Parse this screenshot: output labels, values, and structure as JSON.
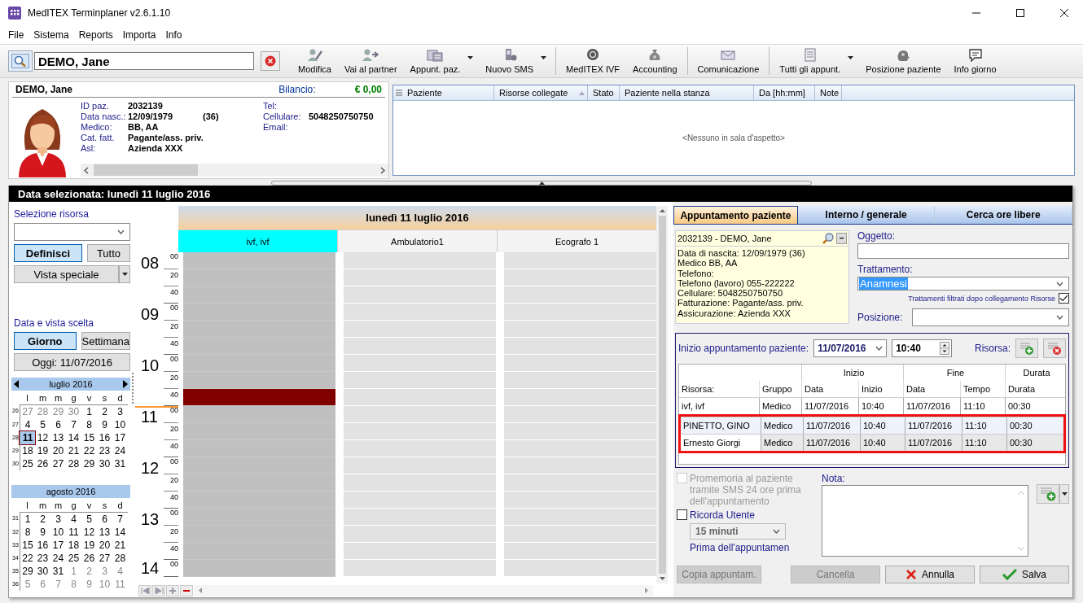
{
  "window": {
    "title": "MedITEX Terminplaner  v2.6.1.10"
  },
  "menu": [
    "File",
    "Sistema",
    "Reports",
    "Importa",
    "Info"
  ],
  "search": {
    "value": "DEMO, Jane"
  },
  "toolbar": [
    {
      "label": "Modifica",
      "dropdown": false,
      "separator_before": false
    },
    {
      "label": "Vai al partner",
      "dropdown": false,
      "separator_before": false
    },
    {
      "label": "Appunt. paz.",
      "dropdown": true,
      "separator_before": false
    },
    {
      "label": "Nuovo SMS",
      "dropdown": true,
      "separator_before": false
    },
    {
      "label": "MedITEX IVF",
      "dropdown": false,
      "separator_before": true
    },
    {
      "label": "Accounting",
      "dropdown": false,
      "separator_before": false
    },
    {
      "label": "Comunicazione",
      "dropdown": false,
      "separator_before": true
    },
    {
      "label": "Tutti gli appunt.",
      "dropdown": true,
      "separator_before": true
    },
    {
      "label": "Posizione paziente",
      "dropdown": false,
      "separator_before": false
    },
    {
      "label": "Info giorno",
      "dropdown": false,
      "separator_before": false
    }
  ],
  "patient": {
    "name": "DEMO, Jane",
    "balance_label": "Bilancio:",
    "balance": "€ 0,00",
    "fields_left": [
      {
        "label": "ID paz.",
        "value": "2032139"
      },
      {
        "label": "Data nasc.:",
        "value": "12/09/1979",
        "extra": "(36)"
      },
      {
        "label": "Medico:",
        "value": "BB, AA"
      },
      {
        "label": "Cat. fatt.",
        "value": "Pagante/ass. priv."
      },
      {
        "label": "Asl:",
        "value": "Azienda XXX"
      }
    ],
    "fields_right": [
      {
        "label": "Tel:"
      },
      {
        "label": "Cellulare:",
        "value": "5048250750750"
      },
      {
        "label": "Email:"
      }
    ]
  },
  "waiting_room": {
    "columns": [
      {
        "label": "Paziente",
        "sorted": false
      },
      {
        "label": "Risorse collegate",
        "sorted": true
      },
      {
        "label": "Stato",
        "sorted": false
      },
      {
        "label": "Paziente nella stanza",
        "sorted": false
      },
      {
        "label": "Da [hh:mm]",
        "sorted": false
      },
      {
        "label": "Note",
        "sorted": false
      }
    ],
    "empty_message": "<Nessuno in sala d'aspetto>"
  },
  "selected_date": "Data selezionata:  lunedì 11 luglio 2016",
  "sidebar": {
    "resource_label": "Selezione risorsa",
    "resource_buttons": [
      {
        "label": "Definisci",
        "selected": true
      },
      {
        "label": "Tutto",
        "selected": false
      }
    ],
    "special_view": "Vista speciale",
    "view_label": "Data e vista scelta",
    "view_buttons": [
      {
        "label": "Giorno",
        "selected": true
      },
      {
        "label": "Settimana",
        "selected": false
      }
    ],
    "today": "Oggi: 11/07/2016",
    "calendars": [
      {
        "title": "luglio 2016",
        "arrows": true,
        "weekdays": [
          "l",
          "m",
          "m",
          "g",
          "v",
          "s",
          "d"
        ],
        "weeks": [
          {
            "week": "26",
            "days": [
              {
                "t": "27",
                "muted": true,
                "selected": false
              },
              {
                "t": "28",
                "muted": true,
                "selected": false
              },
              {
                "t": "29",
                "muted": true,
                "selected": false
              },
              {
                "t": "30",
                "muted": true,
                "selected": false
              },
              {
                "t": "1",
                "muted": false,
                "selected": false
              },
              {
                "t": "2",
                "muted": false,
                "selected": false
              },
              {
                "t": "3",
                "muted": false,
                "selected": false
              }
            ]
          },
          {
            "week": "27",
            "days": [
              {
                "t": "4",
                "muted": false,
                "selected": false
              },
              {
                "t": "5",
                "muted": false,
                "selected": false
              },
              {
                "t": "6",
                "muted": false,
                "selected": false
              },
              {
                "t": "7",
                "muted": false,
                "selected": false
              },
              {
                "t": "8",
                "muted": false,
                "selected": false
              },
              {
                "t": "9",
                "muted": false,
                "selected": false
              },
              {
                "t": "10",
                "muted": false,
                "selected": false
              }
            ]
          },
          {
            "week": "28",
            "days": [
              {
                "t": "11",
                "muted": false,
                "selected": true
              },
              {
                "t": "12",
                "muted": false,
                "selected": false
              },
              {
                "t": "13",
                "muted": false,
                "selected": false
              },
              {
                "t": "14",
                "muted": false,
                "selected": false
              },
              {
                "t": "15",
                "muted": false,
                "selected": false
              },
              {
                "t": "16",
                "muted": false,
                "selected": false
              },
              {
                "t": "17",
                "muted": false,
                "selected": false
              }
            ]
          },
          {
            "week": "29",
            "days": [
              {
                "t": "18",
                "muted": false,
                "selected": false
              },
              {
                "t": "19",
                "muted": false,
                "selected": false
              },
              {
                "t": "20",
                "muted": false,
                "selected": false
              },
              {
                "t": "21",
                "muted": false,
                "selected": false
              },
              {
                "t": "22",
                "muted": false,
                "selected": false
              },
              {
                "t": "23",
                "muted": false,
                "selected": false
              },
              {
                "t": "24",
                "muted": false,
                "selected": false
              }
            ]
          },
          {
            "week": "30",
            "days": [
              {
                "t": "25",
                "muted": false,
                "selected": false
              },
              {
                "t": "26",
                "muted": false,
                "selected": false
              },
              {
                "t": "27",
                "muted": false,
                "selected": false
              },
              {
                "t": "28",
                "muted": false,
                "selected": false
              },
              {
                "t": "29",
                "muted": false,
                "selected": false
              },
              {
                "t": "30",
                "muted": false,
                "selected": false
              },
              {
                "t": "31",
                "muted": false,
                "selected": false
              }
            ]
          }
        ]
      },
      {
        "title": "agosto 2016",
        "arrows": false,
        "weekdays": [
          "l",
          "m",
          "m",
          "g",
          "v",
          "s",
          "d"
        ],
        "weeks": [
          {
            "week": "31",
            "days": [
              {
                "t": "1",
                "muted": false,
                "selected": false
              },
              {
                "t": "2",
                "muted": false,
                "selected": false
              },
              {
                "t": "3",
                "muted": false,
                "selected": false
              },
              {
                "t": "4",
                "muted": false,
                "selected": false
              },
              {
                "t": "5",
                "muted": false,
                "selected": false
              },
              {
                "t": "6",
                "muted": false,
                "selected": false
              },
              {
                "t": "7",
                "muted": false,
                "selected": false
              }
            ]
          },
          {
            "week": "32",
            "days": [
              {
                "t": "8",
                "muted": false,
                "selected": false
              },
              {
                "t": "9",
                "muted": false,
                "selected": false
              },
              {
                "t": "10",
                "muted": false,
                "selected": false
              },
              {
                "t": "11",
                "muted": false,
                "selected": false
              },
              {
                "t": "12",
                "muted": false,
                "selected": false
              },
              {
                "t": "13",
                "muted": false,
                "selected": false
              },
              {
                "t": "14",
                "muted": false,
                "selected": false
              }
            ]
          },
          {
            "week": "33",
            "days": [
              {
                "t": "15",
                "muted": false,
                "selected": false
              },
              {
                "t": "16",
                "muted": false,
                "selected": false
              },
              {
                "t": "17",
                "muted": false,
                "selected": false
              },
              {
                "t": "18",
                "muted": false,
                "selected": false
              },
              {
                "t": "19",
                "muted": false,
                "selected": false
              },
              {
                "t": "20",
                "muted": false,
                "selected": false
              },
              {
                "t": "21",
                "muted": false,
                "selected": false
              }
            ]
          },
          {
            "week": "34",
            "days": [
              {
                "t": "22",
                "muted": false,
                "selected": false
              },
              {
                "t": "23",
                "muted": false,
                "selected": false
              },
              {
                "t": "24",
                "muted": false,
                "selected": false
              },
              {
                "t": "25",
                "muted": false,
                "selected": false
              },
              {
                "t": "26",
                "muted": false,
                "selected": false
              },
              {
                "t": "27",
                "muted": false,
                "selected": false
              },
              {
                "t": "28",
                "muted": false,
                "selected": false
              }
            ]
          },
          {
            "week": "35",
            "days": [
              {
                "t": "29",
                "muted": false,
                "selected": false
              },
              {
                "t": "30",
                "muted": false,
                "selected": false
              },
              {
                "t": "31",
                "muted": false,
                "selected": false
              },
              {
                "t": "1",
                "muted": true,
                "selected": false
              },
              {
                "t": "2",
                "muted": true,
                "selected": false
              },
              {
                "t": "3",
                "muted": true,
                "selected": false
              },
              {
                "t": "4",
                "muted": true,
                "selected": false
              }
            ]
          },
          {
            "week": "36",
            "days": [
              {
                "t": "5",
                "muted": true,
                "selected": false
              },
              {
                "t": "6",
                "muted": true,
                "selected": false
              },
              {
                "t": "7",
                "muted": true,
                "selected": false
              },
              {
                "t": "8",
                "muted": true,
                "selected": false
              },
              {
                "t": "9",
                "muted": true,
                "selected": false
              },
              {
                "t": "10",
                "muted": true,
                "selected": false
              },
              {
                "t": "11",
                "muted": true,
                "selected": false
              }
            ]
          }
        ]
      }
    ]
  },
  "schedule": {
    "day_title": "lunedì 11 luglio 2016",
    "columns": [
      {
        "name": "ivf, ivf",
        "selected": true,
        "busy": true
      },
      {
        "name": "Ambulatorio1",
        "selected": false,
        "busy": false
      },
      {
        "name": "Ecografo 1",
        "selected": false,
        "busy": false
      }
    ],
    "hours": [
      {
        "hour": "08",
        "minutes": [
          {
            "t": "00",
            "booked": false
          },
          {
            "t": "20",
            "booked": false
          },
          {
            "t": "40",
            "booked": false
          }
        ],
        "current": false
      },
      {
        "hour": "09",
        "minutes": [
          {
            "t": "00",
            "booked": false
          },
          {
            "t": "20",
            "booked": false
          },
          {
            "t": "40",
            "booked": false
          }
        ],
        "current": false
      },
      {
        "hour": "10",
        "minutes": [
          {
            "t": "00",
            "booked": false
          },
          {
            "t": "20",
            "booked": false
          },
          {
            "t": "40",
            "booked": true
          }
        ],
        "current": false
      },
      {
        "hour": "11",
        "minutes": [
          {
            "t": "00",
            "booked": false
          },
          {
            "t": "20",
            "booked": false
          },
          {
            "t": "40",
            "booked": false
          }
        ],
        "current": true
      },
      {
        "hour": "12",
        "minutes": [
          {
            "t": "00",
            "booked": false
          },
          {
            "t": "20",
            "booked": false
          },
          {
            "t": "40",
            "booked": false
          }
        ],
        "current": false
      },
      {
        "hour": "13",
        "minutes": [
          {
            "t": "00",
            "booked": false
          },
          {
            "t": "20",
            "booked": false
          },
          {
            "t": "40",
            "booked": false
          }
        ],
        "current": false
      },
      {
        "hour": "14",
        "minutes": [
          {
            "t": "00",
            "booked": false
          }
        ],
        "current": false
      }
    ]
  },
  "appointment": {
    "tabs": [
      {
        "label": "Appuntamento paziente",
        "selected": true
      },
      {
        "label": "Interno / generale",
        "selected": false
      },
      {
        "label": "Cerca ore libere",
        "selected": false
      }
    ],
    "patient_title": "2032139 - DEMO, Jane",
    "patient_lines": [
      "Data di nascita: 12/09/1979 (36)",
      "Medico BB, AA",
      "Telefono:",
      "Telefono (lavoro) 055-222222",
      "Cellulare: 5048250750750",
      "Fatturazione: Pagante/ass. priv.",
      "Assicurazione: Azienda XXX"
    ],
    "subject_label": "Oggetto:",
    "treatment_label": "Trattamento:",
    "treatment": "Anamnesi",
    "filter_label": "Trattamenti filtrati dopo collegamento Risorse",
    "filter_checked": true,
    "position_label": "Posizione:",
    "start_label": "Inizio appuntamento paziente:",
    "start_date": "11/07/2016",
    "start_time": "10:40",
    "resource_label": "Risorsa:",
    "groups": [
      "Inizio",
      "Fine",
      "Durata"
    ],
    "columns": [
      "Risorsa:",
      "Gruppo",
      "Data",
      "Inizio",
      "Data",
      "Tempo",
      "Durata"
    ],
    "rows": [
      {
        "cells": [
          "ivf, ivf",
          "Medico",
          "11/07/2016",
          "10:40",
          "11/07/2016",
          "11:10",
          "00:30"
        ],
        "selected": false,
        "inactive": false,
        "marked": false
      },
      {
        "cells": [
          "PINETTO, GINO",
          "Medico",
          "11/07/2016",
          "10:40",
          "11/07/2016",
          "11:10",
          "00:30"
        ],
        "selected": true,
        "inactive": false,
        "marked": true
      },
      {
        "cells": [
          "Ernesto Giorgi",
          "Medico",
          "11/07/2016",
          "10:40",
          "11/07/2016",
          "11:10",
          "00:30"
        ],
        "selected": false,
        "inactive": true,
        "marked": true
      }
    ],
    "sms_label": "Promemoria al paziente tramite SMS 24 ore prima dell'appuntamento",
    "sms_checked": false,
    "sms_disabled": true,
    "remind_label": "Ricorda Utente",
    "remind_checked": false,
    "remind_time": "15 minuti",
    "remind_after": "Prima dell'appuntamen",
    "note_label": "Nota:",
    "buttons": [
      {
        "label": "Copia appuntam.",
        "kind": "plain",
        "disabled": true
      },
      {
        "label": "Cancella",
        "kind": "plain",
        "disabled": true
      },
      {
        "label": "Annulla",
        "kind": "cancel",
        "disabled": false
      },
      {
        "label": "Salva",
        "kind": "save",
        "disabled": false
      }
    ]
  }
}
